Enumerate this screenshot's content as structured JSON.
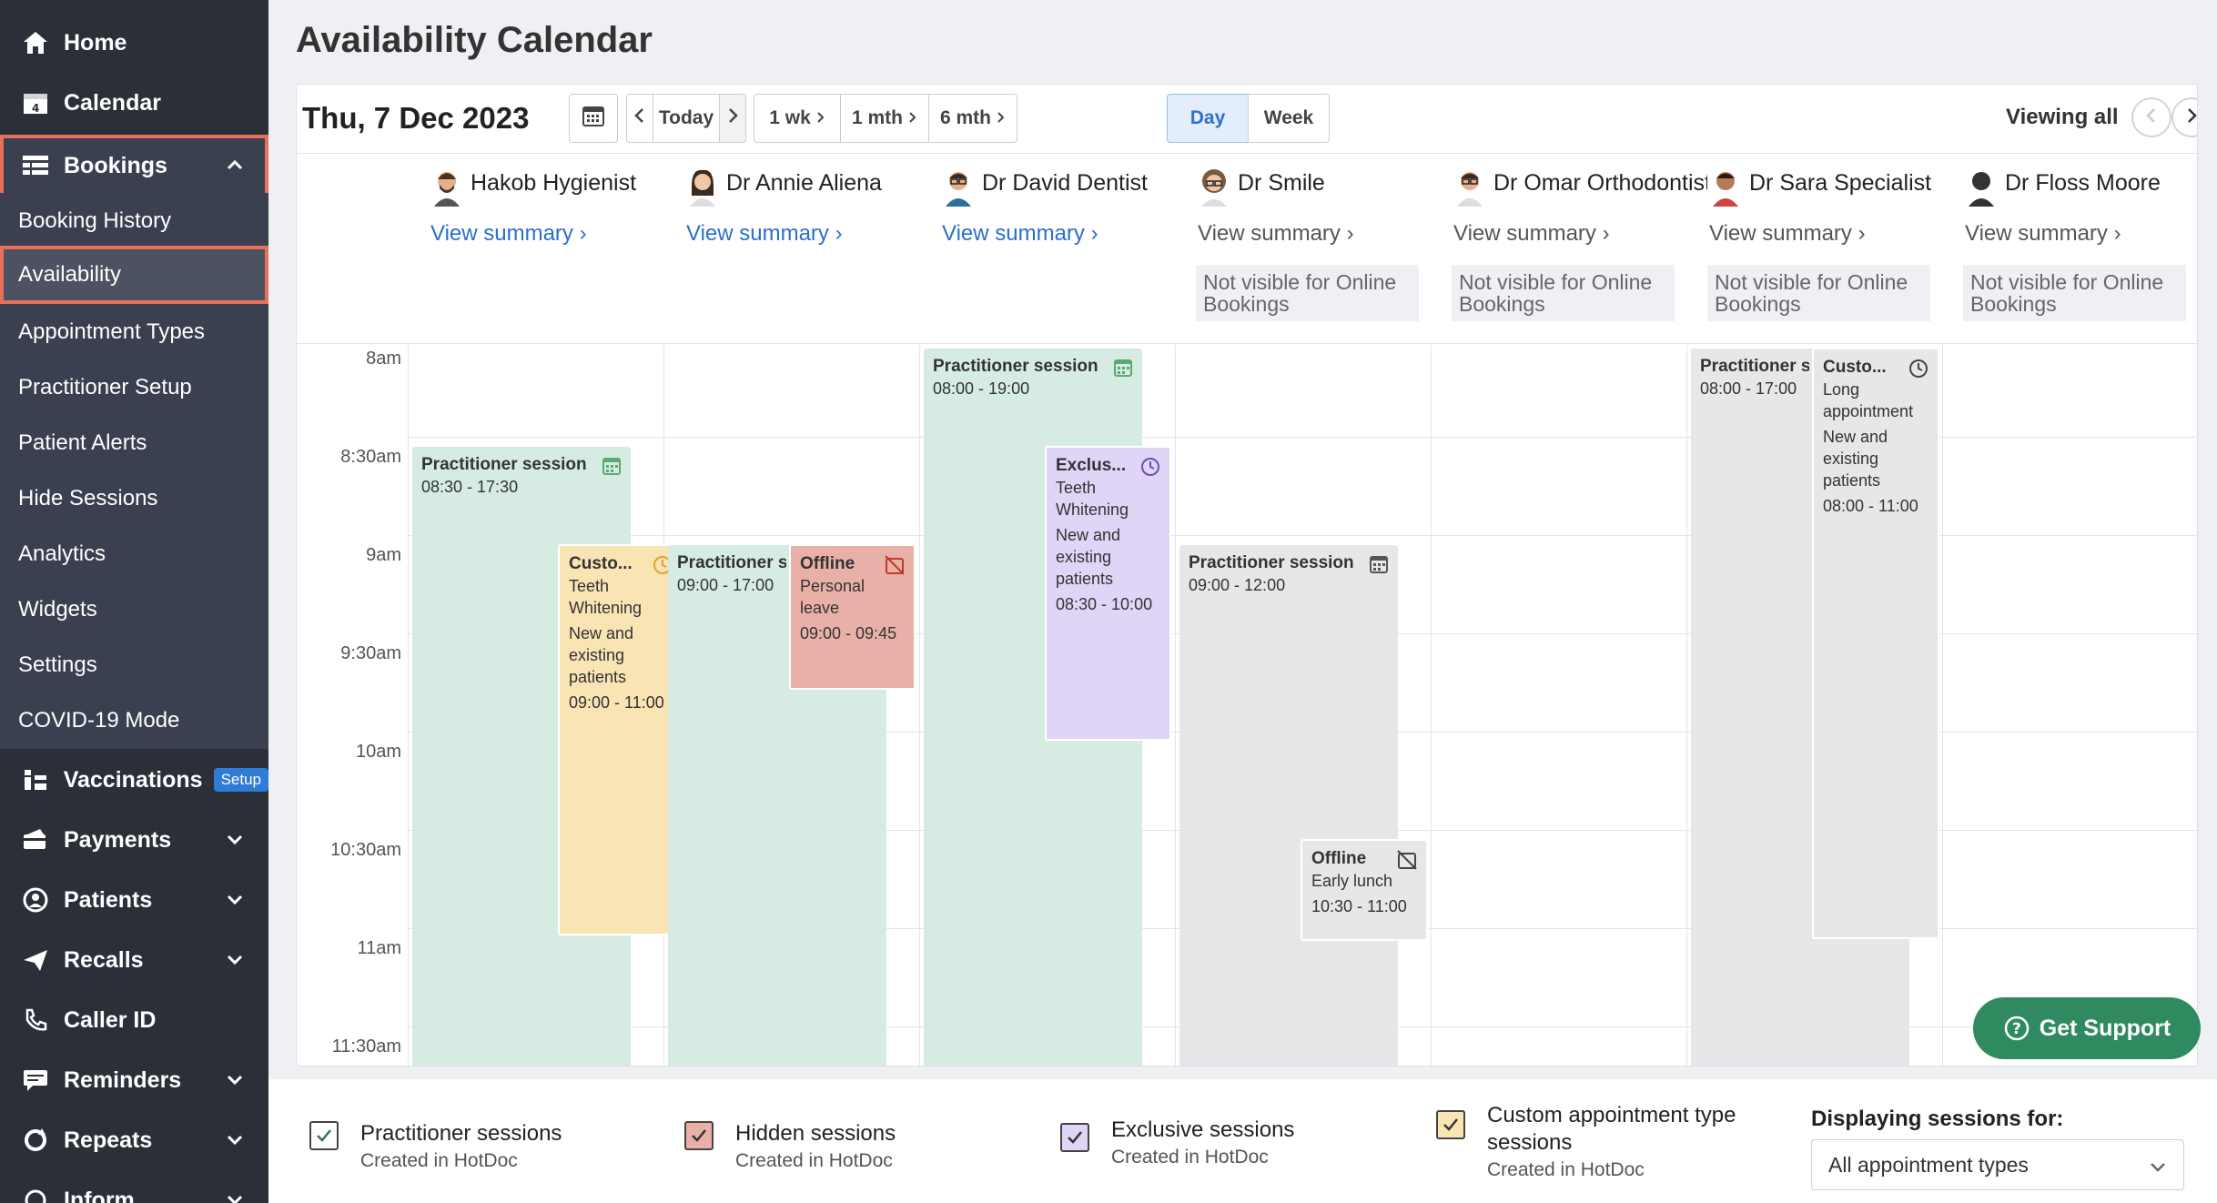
{
  "sidebar": {
    "home": "Home",
    "calendar": "Calendar",
    "bookings": "Bookings",
    "sub": [
      "Booking History",
      "Availability",
      "Appointment Types",
      "Practitioner Setup",
      "Patient Alerts",
      "Hide Sessions",
      "Analytics",
      "Widgets",
      "Settings",
      "COVID-19 Mode"
    ],
    "vaccinations": "Vaccinations",
    "vaccinations_badge": "Setup",
    "payments": "Payments",
    "patients": "Patients",
    "recalls": "Recalls",
    "caller_id": "Caller ID",
    "reminders": "Reminders",
    "repeats": "Repeats",
    "inform": "Inform"
  },
  "page": {
    "title": "Availability Calendar"
  },
  "toolbar": {
    "date": "Thu, 7 Dec 2023",
    "today": "Today",
    "one_wk": "1 wk",
    "one_mth": "1 mth",
    "six_mth": "6 mth",
    "day": "Day",
    "week": "Week",
    "viewing": "Viewing all"
  },
  "practitioners": [
    {
      "name": "Hakob Hygienist",
      "summary": "View summary",
      "online": true
    },
    {
      "name": "Dr Annie Aliena",
      "summary": "View summary",
      "online": true
    },
    {
      "name": "Dr David Dentist",
      "summary": "View summary",
      "online": true
    },
    {
      "name": "Dr Smile",
      "summary": "View summary",
      "online": false
    },
    {
      "name": "Dr Omar Orthodontist",
      "summary": "View summary",
      "online": false
    },
    {
      "name": "Dr Sara Specialist",
      "summary": "View summary",
      "online": false
    },
    {
      "name": "Dr Floss Moore",
      "summary": "View summary",
      "online": false
    }
  ],
  "not_visible_text": "Not visible for Online Bookings",
  "times": [
    "8am",
    "8:30am",
    "9am",
    "9:30am",
    "10am",
    "10:30am",
    "11am",
    "11:30am"
  ],
  "events": {
    "e1": {
      "title": "Practitioner session",
      "time": "08:30 - 17:30"
    },
    "e2": {
      "title": "Custo...",
      "line1": "Teeth Whitening",
      "line2": "New and existing patients",
      "time": "09:00 - 11:00"
    },
    "e3": {
      "title": "Practitioner session",
      "time": "09:00 - 17:00"
    },
    "e4": {
      "title": "Offline",
      "line1": "Personal leave",
      "time": "09:00 - 09:45"
    },
    "e5": {
      "title": "Practitioner session",
      "time": "08:00 - 19:00"
    },
    "e6": {
      "title": "Exclus...",
      "line1": "Teeth Whitening",
      "line2": "New and existing patients",
      "time": "08:30 - 10:00"
    },
    "e7": {
      "title": "Practitioner session",
      "time": "09:00 - 12:00"
    },
    "e8": {
      "title": "Offline",
      "line1": "Early lunch",
      "time": "10:30 - 11:00"
    },
    "e9": {
      "title": "Practitioner session",
      "time": "08:00 - 17:00"
    },
    "e10": {
      "title": "Custo...",
      "line1": "Long appointment",
      "line2": "New and existing patients",
      "time": "08:00 - 11:00"
    }
  },
  "support": "Get Support",
  "legend": {
    "practitioner": {
      "title": "Practitioner sessions",
      "sub": "Created in HotDoc"
    },
    "hidden": {
      "title": "Hidden sessions",
      "sub": "Created in HotDoc"
    },
    "exclusive": {
      "title": "Exclusive sessions",
      "sub": "Created in HotDoc"
    },
    "custom": {
      "title1": "Custom appointment type",
      "title2": "sessions",
      "sub": "Created in HotDoc"
    },
    "displaying_label": "Displaying sessions for:",
    "displaying_value": "All appointment types"
  },
  "colors": {
    "sidebar_bg": "#2a2f38",
    "accent": "#2b6fcc",
    "practitioner": "#d6ece2",
    "custom": "#f9e4b4",
    "hidden": "#e9b0a8",
    "exclusive": "#e0d5f7",
    "support": "#2f8a60",
    "highlight": "#e8705a"
  }
}
